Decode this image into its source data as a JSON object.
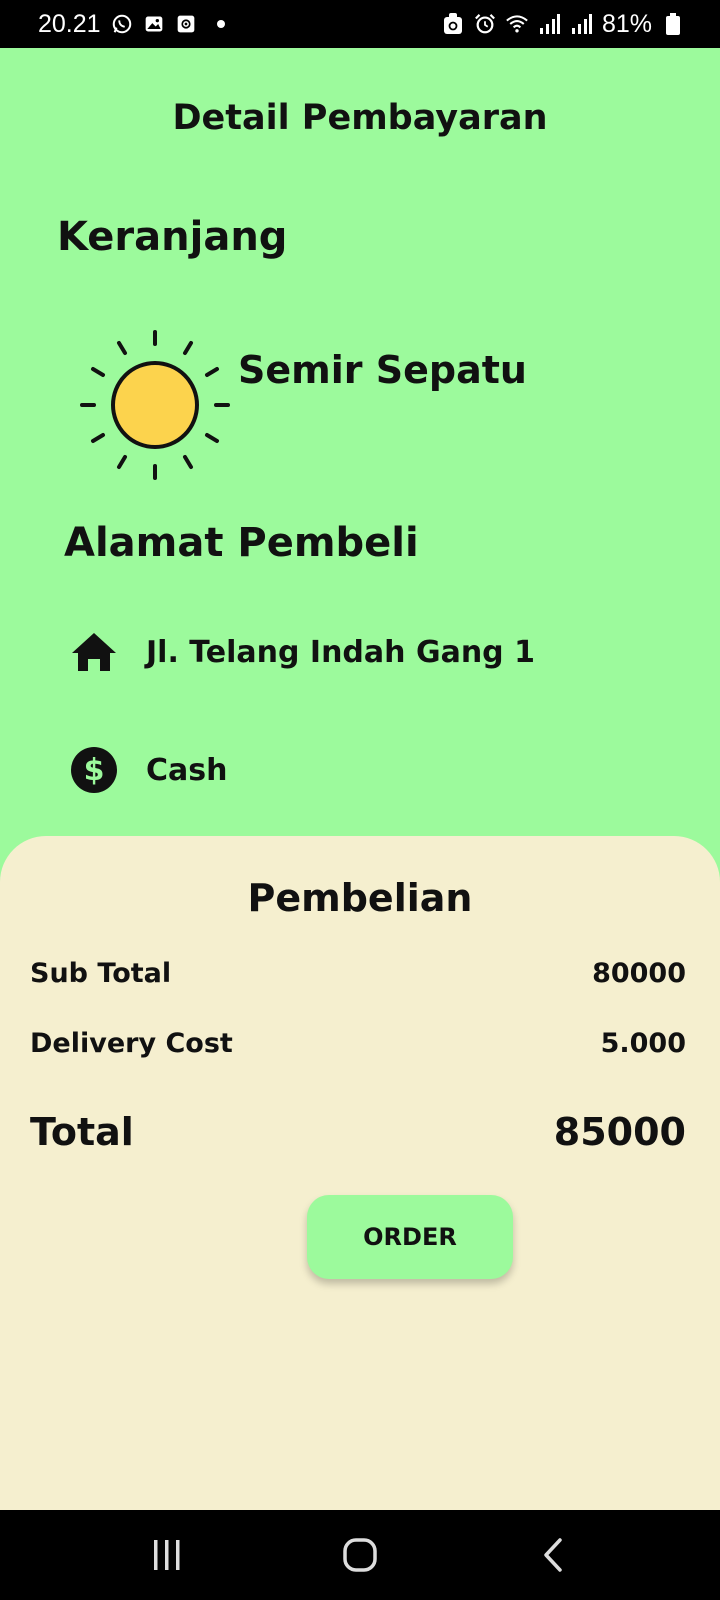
{
  "status_bar": {
    "time": "20.21",
    "icons_left": [
      "whatsapp-icon",
      "gallery-icon",
      "screen-record-icon",
      "notification-dot"
    ],
    "icons_right": [
      "nfc-icon",
      "alarm-icon",
      "wifi-icon",
      "signal-icon",
      "signal-icon",
      "battery-icon"
    ],
    "battery": "81%"
  },
  "header": {
    "title": "Detail Pembayaran"
  },
  "cart": {
    "title": "Keranjang",
    "product_icon": "sun-icon",
    "product_name": "Semir Sepatu"
  },
  "buyer": {
    "title": "Alamat Pembeli",
    "address_icon": "home-icon",
    "address": "Jl. Telang Indah Gang 1",
    "payment_icon": "dollar-icon",
    "payment_method": "Cash"
  },
  "summary": {
    "title": "Pembelian",
    "subtotal_label": "Sub Total",
    "subtotal_value": "80000",
    "delivery_label": "Delivery Cost",
    "delivery_value": "5.000",
    "total_label": "Total",
    "total_value": "85000",
    "order_label": "ORDER"
  },
  "nav_bar": {
    "buttons": [
      "recents-icon",
      "home-button-icon",
      "back-icon"
    ]
  },
  "colors": {
    "background": "#9cfa9c",
    "sheet": "#f5efcf",
    "button": "#9cfa9c",
    "sun": "#fcd34d"
  }
}
